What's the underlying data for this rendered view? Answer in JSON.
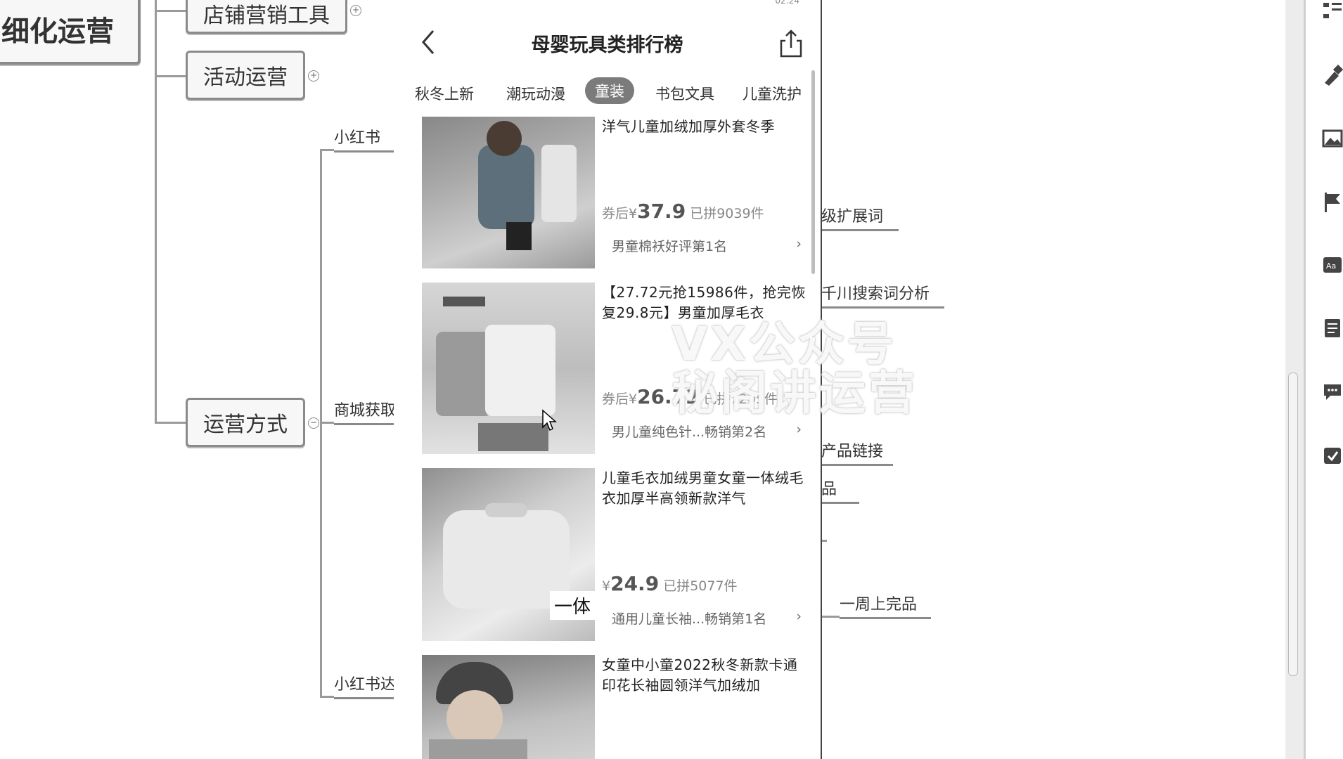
{
  "mindmap": {
    "root_label": "细化运营",
    "nodes": {
      "store_tools": "店铺营销工具",
      "activity_ops": "活动运营",
      "ops_method": "运营方式"
    },
    "leaves_left": {
      "xhs_1": "小红书",
      "mall": "商城获取",
      "xhs_2": "小红书达"
    },
    "leaves_right": {
      "expand_words": "级扩展词",
      "qianchuan": "千川搜索词分析",
      "product_link": "产品链接",
      "product_short": "品",
      "weekly": "一周上完品"
    }
  },
  "phone": {
    "status_bar": "02:24",
    "title": "母婴玩具类排行榜",
    "tabs": [
      {
        "label": "秋冬上新",
        "active": false
      },
      {
        "label": "潮玩动漫",
        "active": false
      },
      {
        "label": "童装",
        "active": true
      },
      {
        "label": "书包文具",
        "active": false
      },
      {
        "label": "儿童洗护",
        "active": false
      }
    ],
    "products": [
      {
        "title": "洋气儿童加绒加厚外套冬季",
        "price_prefix": "券后¥",
        "price": "37.9",
        "sold": "已拼9039件",
        "rank": "男童棉袄好评第1名"
      },
      {
        "title": "【27.72元抢15986件，抢完恢复29.8元】男童加厚毛衣",
        "price_prefix": "券后¥",
        "price": "26.72",
        "sold": "已拼7205件",
        "rank": "男儿童纯色针...畅销第2名"
      },
      {
        "title": "儿童毛衣加绒男童女童一体绒毛衣加厚半高领新款洋气",
        "price_prefix": "¥",
        "price": "24.9",
        "sold": "已拼5077件",
        "rank": "通用儿童长袖...畅销第1名",
        "overlay": "一体"
      },
      {
        "title": "女童中小童2022秋冬新款卡通印花长袖圆领洋气加绒加"
      }
    ]
  },
  "watermark": {
    "line1": "VX公众号",
    "line2": "秘阁讲运营"
  },
  "icons": {
    "back": "chevron-left-icon",
    "share": "share-icon",
    "rank_chevron": "chevron-right-icon"
  },
  "colors": {
    "tab_active_bg": "#7b7b7b",
    "node_border": "#8a8a8a"
  }
}
